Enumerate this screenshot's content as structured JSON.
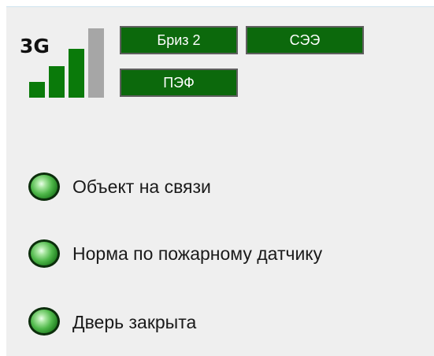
{
  "signal": {
    "label": "3G",
    "icon": "signal-strength-icon",
    "bars": [
      {
        "active": true
      },
      {
        "active": true
      },
      {
        "active": true
      },
      {
        "active": false
      }
    ],
    "colors": {
      "active": "#0a7a0a",
      "inactive": "#a6a6a6"
    }
  },
  "tags": [
    {
      "label": "Бриз 2"
    },
    {
      "label": "СЭЭ"
    },
    {
      "label": "ПЭФ"
    }
  ],
  "tag_colors": {
    "background": "#0c690c",
    "border": "#5f5f5f",
    "text": "#ffffff"
  },
  "statuses": [
    {
      "label": "Объект на связи",
      "indicator": "green-led-icon",
      "color": "#1f7d1f"
    },
    {
      "label": "Норма по пожарному датчику",
      "indicator": "green-led-icon",
      "color": "#1f7d1f"
    },
    {
      "label": "Дверь закрыта",
      "indicator": "green-led-icon",
      "color": "#1f7d1f"
    }
  ]
}
